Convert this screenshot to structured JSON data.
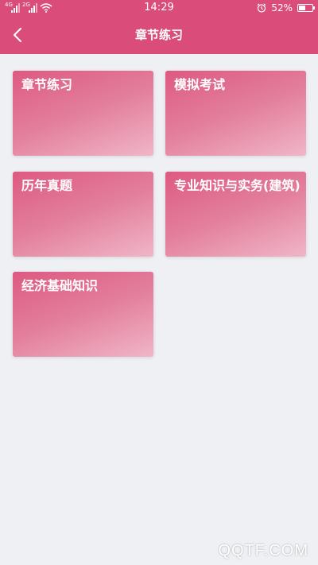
{
  "status_bar": {
    "signal_1_tag": "4G",
    "signal_2_tag": "2G",
    "time": "14:29",
    "battery_text": "52%",
    "battery_level": 0.52
  },
  "header": {
    "title": "章节练习",
    "back_icon": "chevron-left-icon"
  },
  "cards": [
    {
      "label": "章节练习"
    },
    {
      "label": "模拟考试"
    },
    {
      "label": "历年真题"
    },
    {
      "label": "专业知识与实务(建筑)"
    },
    {
      "label": "经济基础知识"
    }
  ],
  "watermark": "QQTF.COM",
  "colors": {
    "primary": "#da4d7a",
    "background": "#eff0f4",
    "card_start": "#dd5a82",
    "card_end": "#f0b6c7"
  }
}
